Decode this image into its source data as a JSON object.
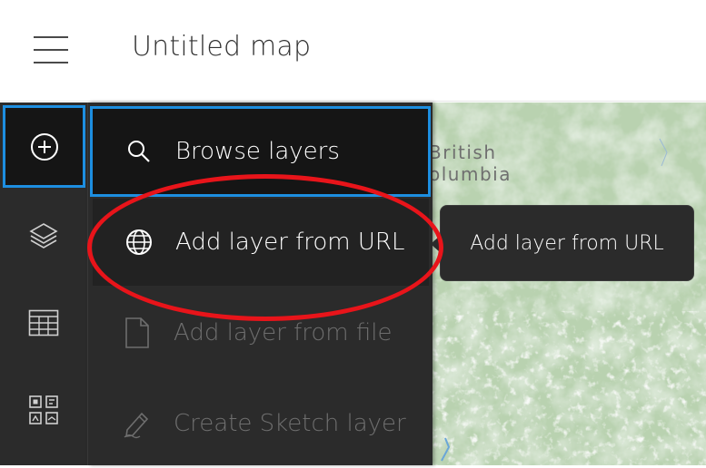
{
  "header": {
    "title": "Untitled map"
  },
  "map": {
    "region_label_line1": "British",
    "region_label_line2": "olumbia"
  },
  "rail": {
    "items": [
      {
        "icon": "add-circle-icon",
        "active": true
      },
      {
        "icon": "layers-icon",
        "active": false
      },
      {
        "icon": "table-icon",
        "active": false
      },
      {
        "icon": "grid-apps-icon",
        "active": false
      }
    ]
  },
  "panel": {
    "items": [
      {
        "label": "Browse layers",
        "icon": "search-icon",
        "state": "selected"
      },
      {
        "label": "Add layer from URL",
        "icon": "globe-icon",
        "state": "hover"
      },
      {
        "label": "Add layer from file",
        "icon": "file-icon",
        "state": "disabled"
      },
      {
        "label": "Create Sketch layer",
        "icon": "sketch-pen-icon",
        "state": "disabled"
      }
    ]
  },
  "tooltip": {
    "text": "Add layer from URL"
  },
  "colors": {
    "accent": "#1d8ee0",
    "annotation": "#e8141a",
    "panel_bg": "#2b2b2b",
    "selected_bg": "#151515"
  }
}
